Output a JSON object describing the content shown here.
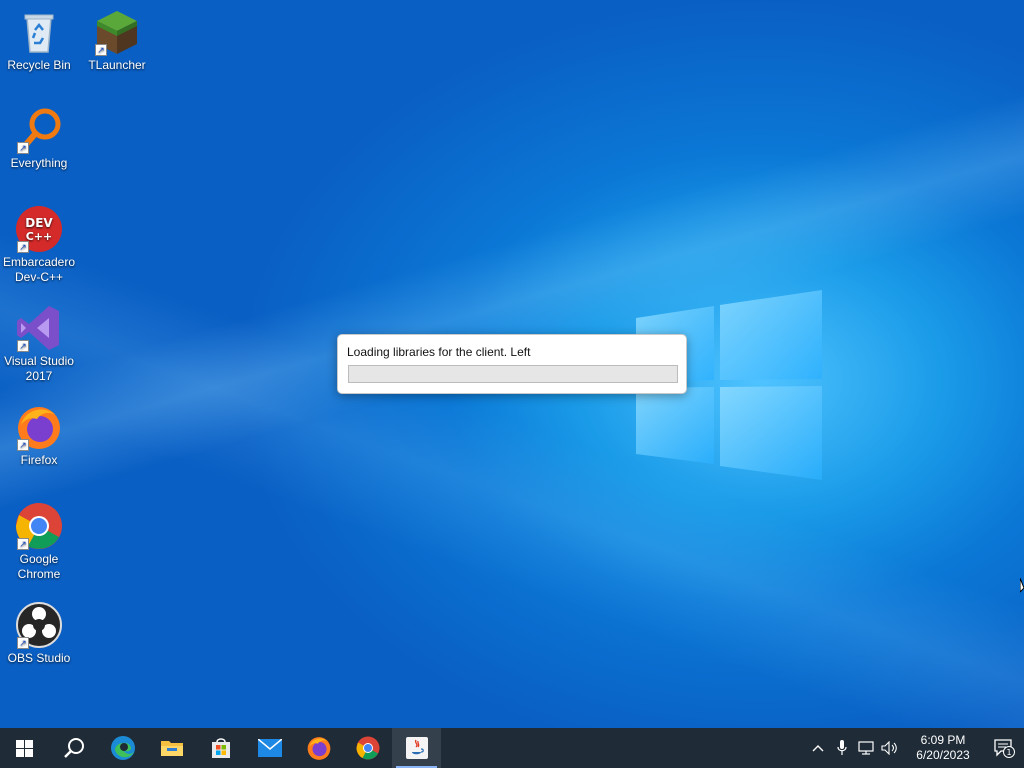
{
  "desktop_icons": [
    {
      "label": "Recycle Bin",
      "icon": "recycle-bin-icon"
    },
    {
      "label": "TLauncher",
      "icon": "tlauncher-icon"
    },
    {
      "label": "Everything",
      "icon": "everything-search-icon"
    },
    {
      "label": "Embarcadero Dev-C++",
      "icon": "devcpp-icon",
      "badge_text": "DEV C++"
    },
    {
      "label": "Visual Studio 2017",
      "icon": "visual-studio-icon"
    },
    {
      "label": "Firefox",
      "icon": "firefox-icon"
    },
    {
      "label": "Google Chrome",
      "icon": "chrome-icon"
    },
    {
      "label": "OBS Studio",
      "icon": "obs-icon"
    }
  ],
  "dialog": {
    "message": "Loading libraries for the client. Left",
    "progress": 0
  },
  "taskbar": {
    "apps": [
      {
        "name": "start",
        "icon": "windows-start-icon"
      },
      {
        "name": "search",
        "icon": "search-icon"
      },
      {
        "name": "edge",
        "icon": "edge-icon"
      },
      {
        "name": "file-explorer",
        "icon": "folder-icon"
      },
      {
        "name": "microsoft-store",
        "icon": "store-icon"
      },
      {
        "name": "mail",
        "icon": "mail-icon"
      },
      {
        "name": "firefox",
        "icon": "firefox-icon"
      },
      {
        "name": "chrome",
        "icon": "chrome-icon"
      },
      {
        "name": "java",
        "icon": "java-icon",
        "active": true
      }
    ],
    "tray": {
      "time": "6:09 PM",
      "date": "6/20/2023",
      "notification_count": "1"
    }
  },
  "colors": {
    "taskbar_bg": "#1f2b36",
    "desktop_blue": "#0a6fd0",
    "progress_green": "#06b025"
  }
}
